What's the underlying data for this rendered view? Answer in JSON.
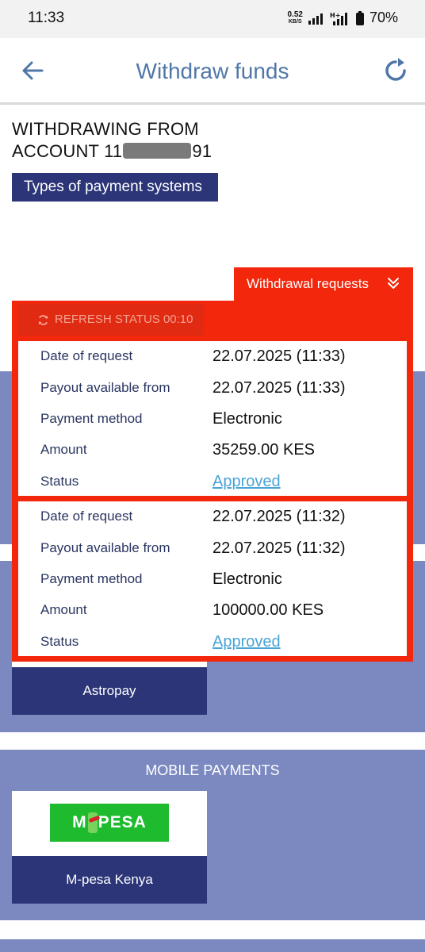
{
  "status_bar": {
    "time": "11:33",
    "net_speed_value": "0.52",
    "net_speed_unit": "KB/S",
    "battery": "70%",
    "icons": [
      "signal-icon",
      "h-plus-signal-icon",
      "battery-icon"
    ]
  },
  "header": {
    "title": "Withdraw funds",
    "back_icon": "arrow-left-icon",
    "refresh_icon": "refresh-icon"
  },
  "withdrawing": {
    "line1": "WITHDRAWING FROM",
    "line2_prefix": "ACCOUNT 11",
    "line2_suffix": "91"
  },
  "types_button": "Types of payment systems",
  "withdrawal_requests": {
    "tab_label": "Withdrawal requests",
    "refresh_status": "REFRESH STATUS 00:10",
    "entries": [
      {
        "rows": [
          {
            "label": "Date of request",
            "value": "22.07.2025 (11:33)"
          },
          {
            "label": "Payout available from",
            "value": "22.07.2025 (11:33)"
          },
          {
            "label": "Payment method",
            "value": "Electronic"
          },
          {
            "label": "Amount",
            "value": "35259.00 KES"
          },
          {
            "label": "Status",
            "value": "Approved"
          }
        ]
      },
      {
        "rows": [
          {
            "label": "Date of request",
            "value": "22.07.2025 (11:32)"
          },
          {
            "label": "Payout available from",
            "value": "22.07.2025 (11:32)"
          },
          {
            "label": "Payment method",
            "value": "Electronic"
          },
          {
            "label": "Amount",
            "value": "100000.00 KES"
          },
          {
            "label": "Status",
            "value": "Approved"
          }
        ]
      }
    ]
  },
  "payment_sections": {
    "astropay_label": "Astropay",
    "mobile_title": "MOBILE PAYMENTS",
    "mpesa_logo_left": "M",
    "mpesa_logo_right": "PESA",
    "mpesa_label": "M-pesa Kenya"
  },
  "colors": {
    "header_title": "#4f77a8",
    "navy": "#2b3577",
    "section_bg": "#7b89c0",
    "accent_red": "#f2270c",
    "link_blue": "#4aa3d6",
    "mpesa_green": "#1ebb2e"
  }
}
